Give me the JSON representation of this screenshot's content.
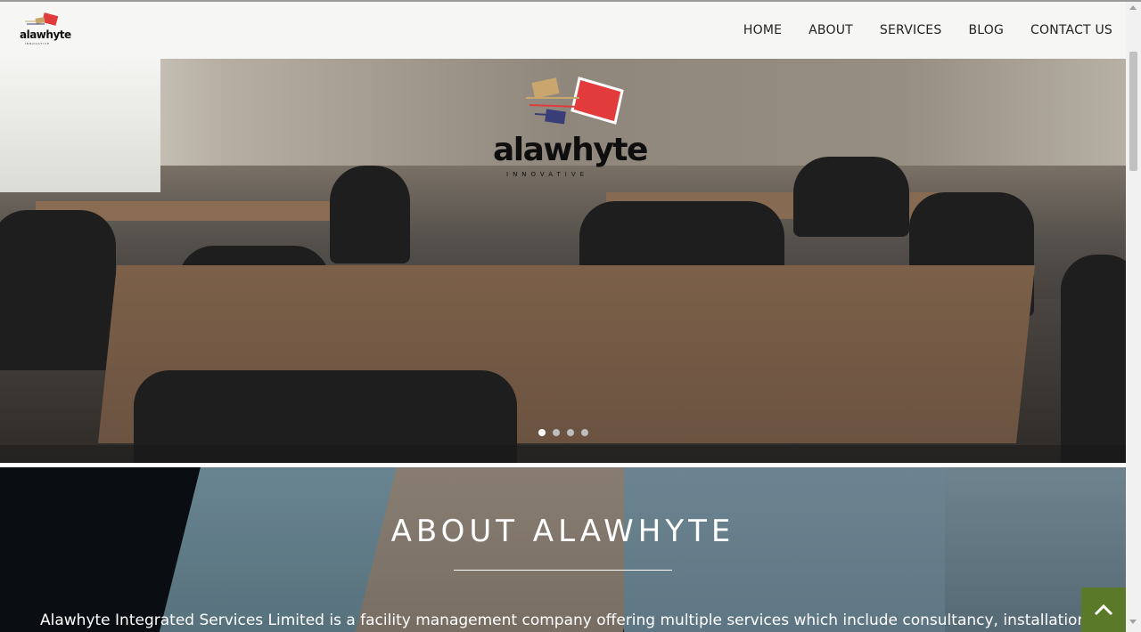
{
  "header": {
    "logo_word": "alawhyte",
    "logo_sub": "INNOVATIVE",
    "nav": [
      "HOME",
      "ABOUT",
      "SERVICES",
      "BLOG",
      "CONTACT US"
    ]
  },
  "hero": {
    "logo_word": "alawhyte",
    "logo_sub": "INNOVATIVE",
    "slide_count": 4,
    "active_slide": 1
  },
  "about": {
    "title": "ABOUT  ALAWHYTE",
    "text": "Alawhyte Integrated Services Limited is a facility management company offering multiple services which include consultancy, installation, and"
  },
  "back_to_top": {
    "icon": "chevron-up-icon",
    "color": "#5a7a2a"
  },
  "colors": {
    "brand_red": "#e23b3b",
    "brand_tan": "#c8a66e",
    "brand_navy": "#3a3e78"
  }
}
